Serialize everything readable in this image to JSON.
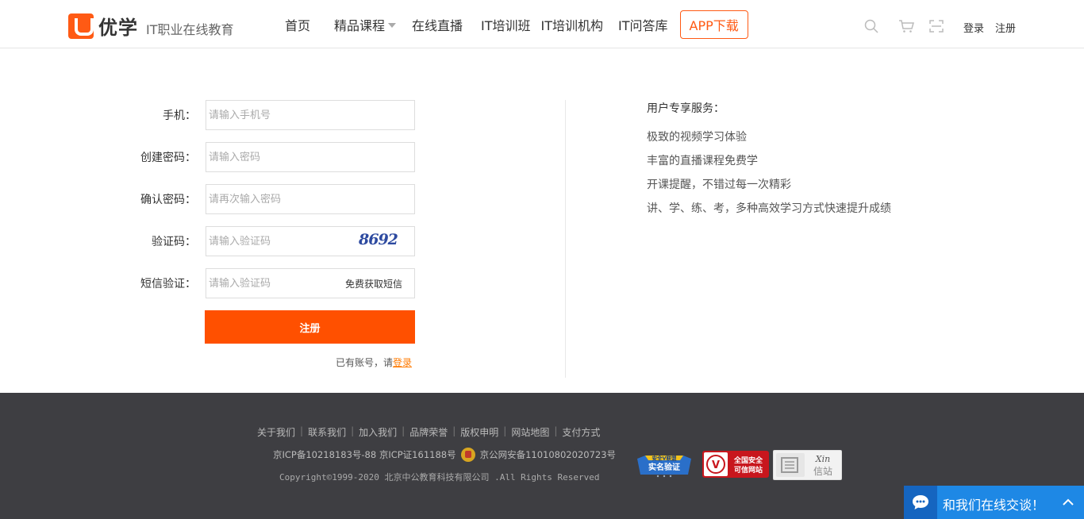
{
  "header": {
    "logo_name": "优学",
    "slogan": "IT职业在线教育",
    "nav": [
      "首页",
      "精品课程",
      "在线直播",
      "IT培训班",
      "IT培训机构",
      "IT问答库"
    ],
    "app_download": "APP下载",
    "login": "登录",
    "register": "注册"
  },
  "form": {
    "phone_label": "手机：",
    "phone_placeholder": "请输入手机号",
    "password_label": "创建密码：",
    "password_placeholder": "请输入密码",
    "confirm_label": "确认密码：",
    "confirm_placeholder": "请再次输入密码",
    "captcha_label": "验证码：",
    "captcha_placeholder": "请输入验证码",
    "captcha_code": "8692",
    "sms_label": "短信验证：",
    "sms_placeholder": "请输入验证码",
    "sms_button": "免费获取短信",
    "submit": "注册",
    "have_account": "已有账号，请",
    "login_link": "登录"
  },
  "services": {
    "title": "用户专享服务：",
    "items": [
      "极致的视频学习体验",
      "丰富的直播课程免费学",
      "开课提醒，不错过每一次精彩",
      "讲、学、练、考，多种高效学习方式快速提升成绩"
    ]
  },
  "footer": {
    "links": [
      "关于我们",
      "联系我们",
      "加入我们",
      "品牌荣誉",
      "版权申明",
      "网站地图",
      "支付方式"
    ],
    "icp": "京ICP备10218183号-88 京ICP证161188号",
    "police": "京公网安备11010802020723号",
    "copyright": "Copyright©1999-2020 北京中公教育科技有限公司 .All Rights Reserved",
    "badge1_top": "安全V联盟",
    "badge1_main": "实名验证",
    "badge2_line1": "全国安全",
    "badge2_line2": "可信网站",
    "badge3_script": "Xin",
    "badge3_text": "信站"
  },
  "chat": {
    "label": "和我们在线交谈！"
  },
  "colors": {
    "brand_orange": "#ff5000",
    "footer_bg": "#3e3e42",
    "chat_blue": "#1e88e5"
  }
}
